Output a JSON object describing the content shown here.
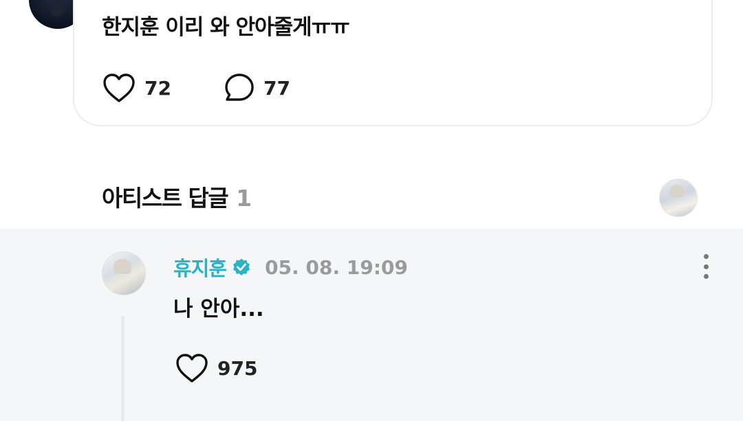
{
  "post": {
    "text": "한지훈 이리 와 안아줄게ㅠㅠ",
    "like_count": "72",
    "comment_count": "77"
  },
  "artist_replies": {
    "title": "아티스트 답글",
    "count": "1"
  },
  "reply": {
    "author": "휴지훈",
    "timestamp": "05. 08. 19:09",
    "text": "나 안아...",
    "like_count": "975"
  },
  "icons": {
    "like": "heart-outline-icon",
    "comment": "speech-bubble-icon",
    "verified": "verified-badge-icon",
    "more": "more-vertical-icon"
  },
  "colors": {
    "author_accent": "#2ab3c4",
    "meta_gray": "#9b9b9b",
    "reply_background": "#f5f6f8"
  }
}
